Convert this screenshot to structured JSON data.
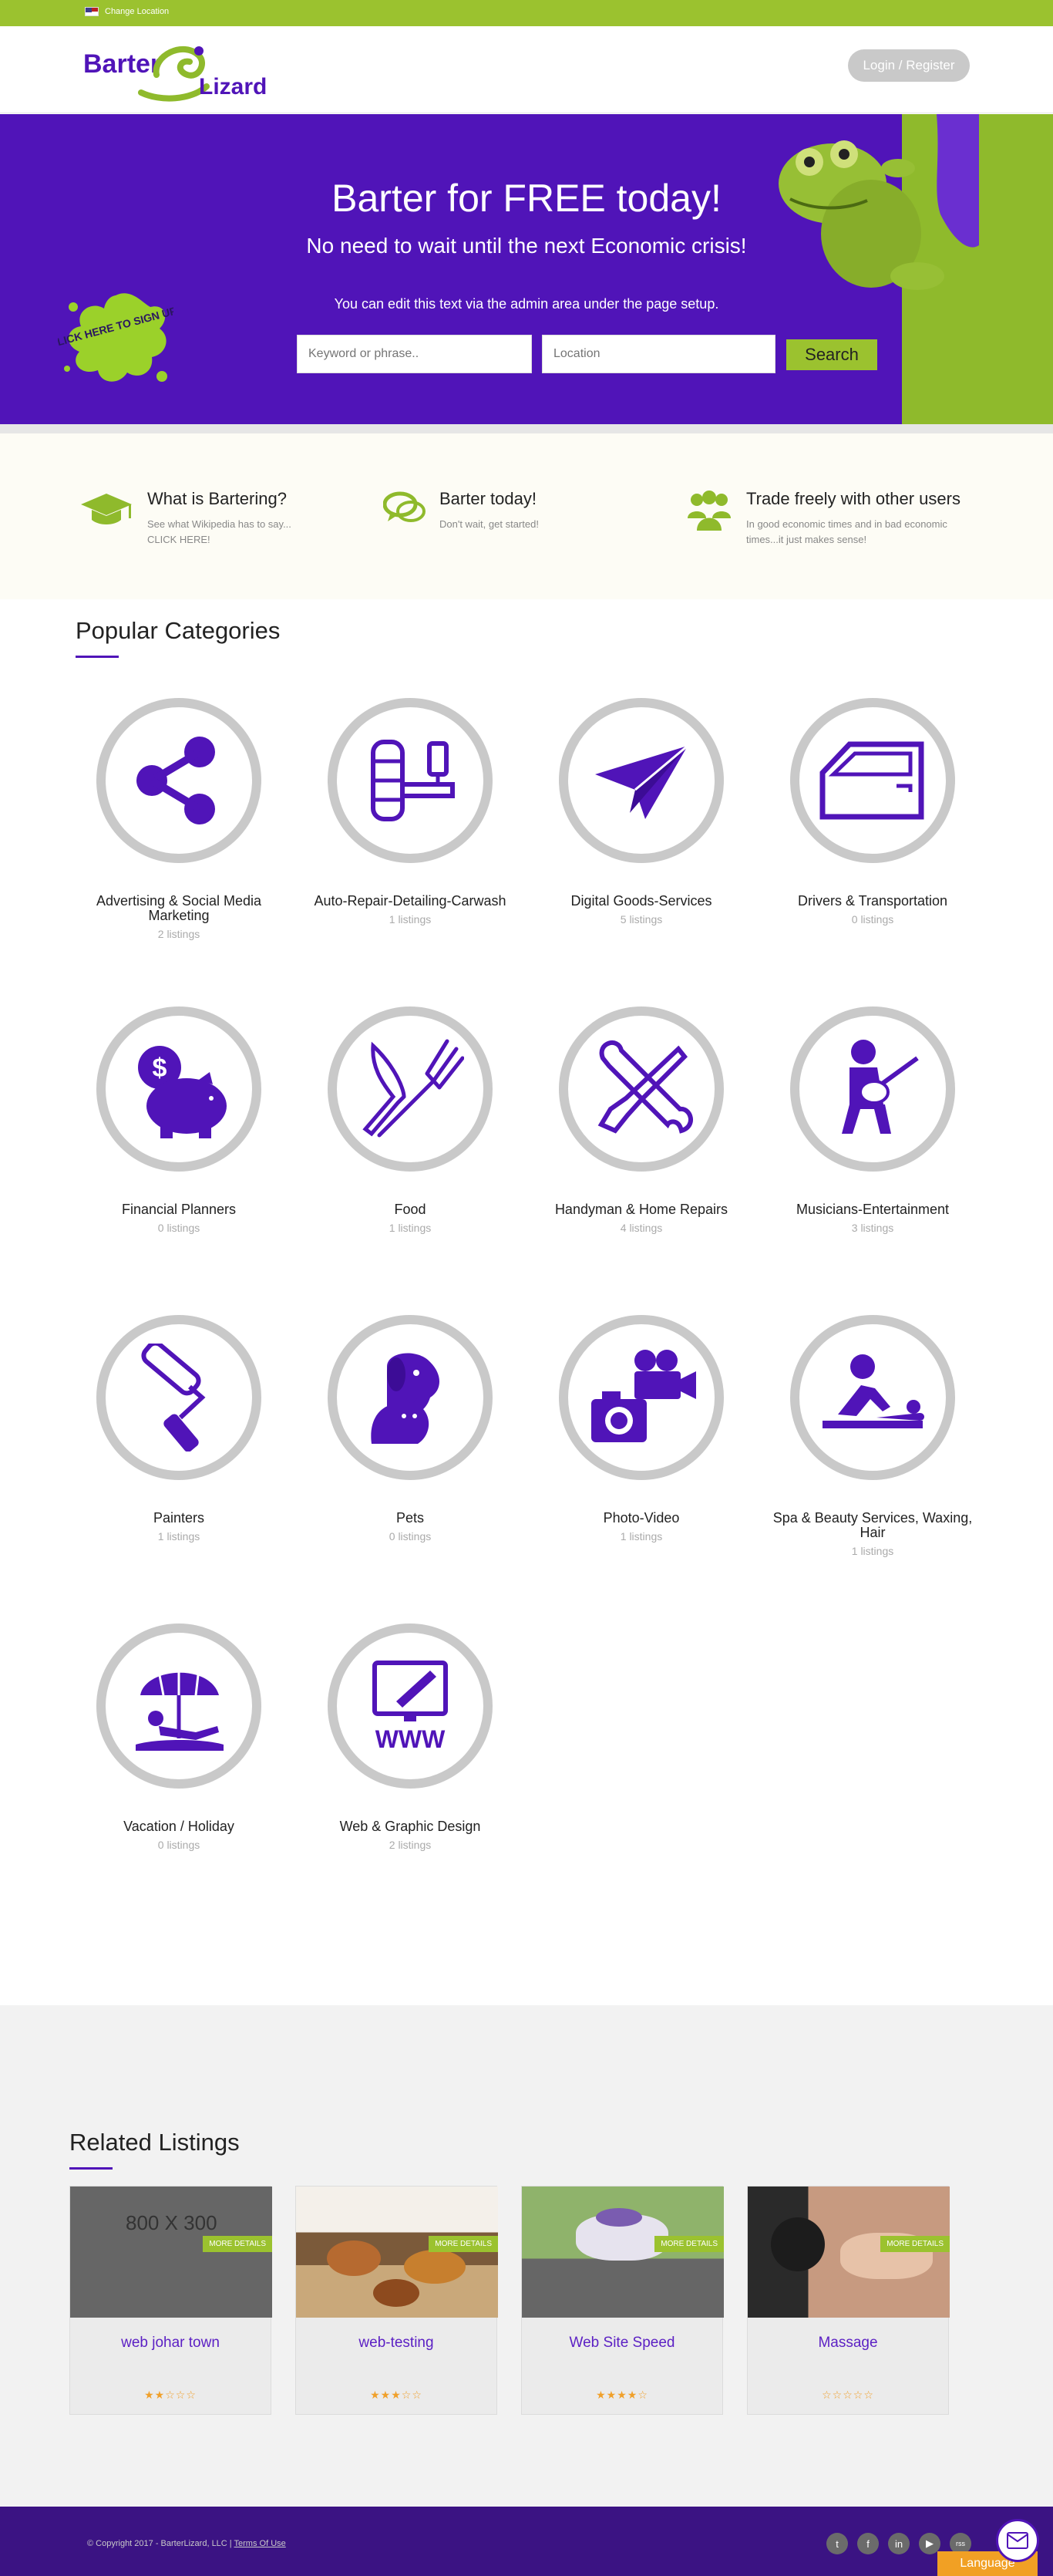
{
  "topbar": {
    "location_label": "Change Location"
  },
  "header": {
    "logo_text_1": "Barter",
    "logo_text_2": "Lizard",
    "login_label": "Login / Register"
  },
  "hero": {
    "title": "Barter for FREE today!",
    "subtitle": "No need to wait until the next Economic crisis!",
    "note": "You can edit this text via the admin area under the page setup.",
    "keyword_placeholder": "Keyword or phrase..",
    "location_placeholder": "Location",
    "search_label": "Search",
    "splat_text": "CLICK HERE TO SIGN UP!"
  },
  "features": [
    {
      "title": "What is Bartering?",
      "text": "See what Wikipedia has to say... CLICK HERE!"
    },
    {
      "title": "Barter today!",
      "text": "Don't wait, get started!"
    },
    {
      "title": "Trade freely with other users",
      "text": "In good economic times and in bad economic times...it just makes sense!"
    }
  ],
  "categories": {
    "title": "Popular Categories",
    "items": [
      {
        "name": "Advertising & Social Media Marketing",
        "count": "2 listings",
        "icon": "share-icon"
      },
      {
        "name": "Auto-Repair-Detailing-Carwash",
        "count": "1 listings",
        "icon": "car-wash-icon"
      },
      {
        "name": "Digital Goods-Services",
        "count": "5 listings",
        "icon": "paper-plane-icon"
      },
      {
        "name": "Drivers & Transportation",
        "count": "0 listings",
        "icon": "car-door-icon"
      },
      {
        "name": "Financial Planners",
        "count": "0 listings",
        "icon": "piggy-bank-icon"
      },
      {
        "name": "Food",
        "count": "1 listings",
        "icon": "knife-fork-icon"
      },
      {
        "name": "Handyman & Home Repairs",
        "count": "4 listings",
        "icon": "tools-icon"
      },
      {
        "name": "Musicians-Entertainment",
        "count": "3 listings",
        "icon": "guitarist-icon"
      },
      {
        "name": "Painters",
        "count": "1 listings",
        "icon": "paint-roller-icon"
      },
      {
        "name": "Pets",
        "count": "0 listings",
        "icon": "pets-icon"
      },
      {
        "name": "Photo-Video",
        "count": "1 listings",
        "icon": "camera-icon"
      },
      {
        "name": "Spa & Beauty Services, Waxing, Hair",
        "count": "1 listings",
        "icon": "massage-icon"
      },
      {
        "name": "Vacation / Holiday",
        "count": "0 listings",
        "icon": "beach-umbrella-icon"
      },
      {
        "name": "Web & Graphic Design",
        "count": "2 listings",
        "icon": "web-design-icon"
      }
    ]
  },
  "related": {
    "title": "Related Listings",
    "more_label": "MORE DETAILS",
    "placeholder_text": "800 X 300",
    "cards": [
      {
        "title": "web johar town",
        "stars": "★★☆☆☆"
      },
      {
        "title": "web-testing",
        "stars": "★★★☆☆"
      },
      {
        "title": "Web Site Speed",
        "stars": "★★★★☆"
      },
      {
        "title": "Massage",
        "stars": "☆☆☆☆☆"
      }
    ]
  },
  "footer": {
    "copyright": "© Copyright 2017 - BarterLizard, LLC |",
    "terms": "Terms Of Use",
    "language_label": "Language",
    "social": [
      "t",
      "f",
      "in",
      "▶",
      "rss"
    ]
  },
  "colors": {
    "brand_purple": "#5014b8",
    "brand_green": "#9bc22f",
    "footer": "#3b1383",
    "accent_orange": "#f1a024"
  }
}
